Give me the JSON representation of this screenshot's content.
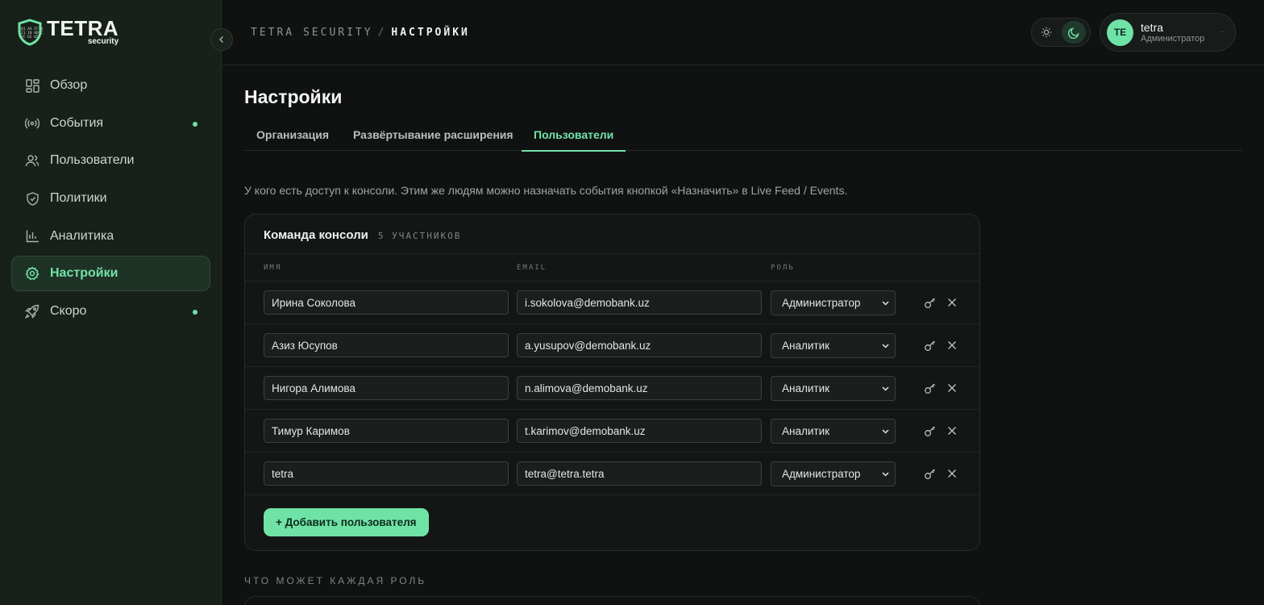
{
  "brand": {
    "logo_word": "TETRA",
    "logo_sub": "security",
    "accent": "#6fe3a6"
  },
  "sidebar": {
    "items": [
      {
        "label": "Обзор",
        "icon": "grid-icon",
        "active": false,
        "dot": false
      },
      {
        "label": "События",
        "icon": "broadcast-icon",
        "active": false,
        "dot": true
      },
      {
        "label": "Пользователи",
        "icon": "users-icon",
        "active": false,
        "dot": false
      },
      {
        "label": "Политики",
        "icon": "shield-icon",
        "active": false,
        "dot": false
      },
      {
        "label": "Аналитика",
        "icon": "bar-chart-icon",
        "active": false,
        "dot": false
      },
      {
        "label": "Настройки",
        "icon": "gear-icon",
        "active": true,
        "dot": false
      },
      {
        "label": "Скоро",
        "icon": "rocket-icon",
        "active": false,
        "dot": true
      }
    ]
  },
  "header": {
    "breadcrumb_root": "TETRA SECURITY",
    "breadcrumb_sep": "/",
    "breadcrumb_current": "НАСТРОЙКИ",
    "theme_mode": "dark",
    "user": {
      "initials": "TE",
      "name": "tetra",
      "role": "Администратор",
      "menu": "·"
    }
  },
  "page": {
    "title": "Настройки",
    "tabs": [
      "Организация",
      "Развёртывание расширения",
      "Пользователи"
    ],
    "active_tab": "Пользователи",
    "intro": "У кого есть доступ к консоли. Этим же людям можно назначать события кнопкой «Назначить» в Live Feed / Events."
  },
  "team": {
    "title": "Команда консоли",
    "count": "5 УЧАСТНИКОВ",
    "columns": [
      "ИМЯ",
      "EMAIL",
      "РОЛЬ"
    ],
    "rows": [
      {
        "name": "Ирина Соколова",
        "email": "i.sokolova@demobank.uz",
        "role": "Администратор"
      },
      {
        "name": "Азиз Юсупов",
        "email": "a.yusupov@demobank.uz",
        "role": "Аналитик"
      },
      {
        "name": "Нигора Алимова",
        "email": "n.alimova@demobank.uz",
        "role": "Аналитик"
      },
      {
        "name": "Тимур Каримов",
        "email": "t.karimov@demobank.uz",
        "role": "Аналитик"
      },
      {
        "name": "tetra",
        "email": "tetra@tetra.tetra",
        "role": "Администратор"
      }
    ],
    "add_button": "+ Добавить пользователя"
  },
  "roles_section": {
    "label": "ЧТО МОЖЕТ КАЖДАЯ РОЛЬ"
  }
}
